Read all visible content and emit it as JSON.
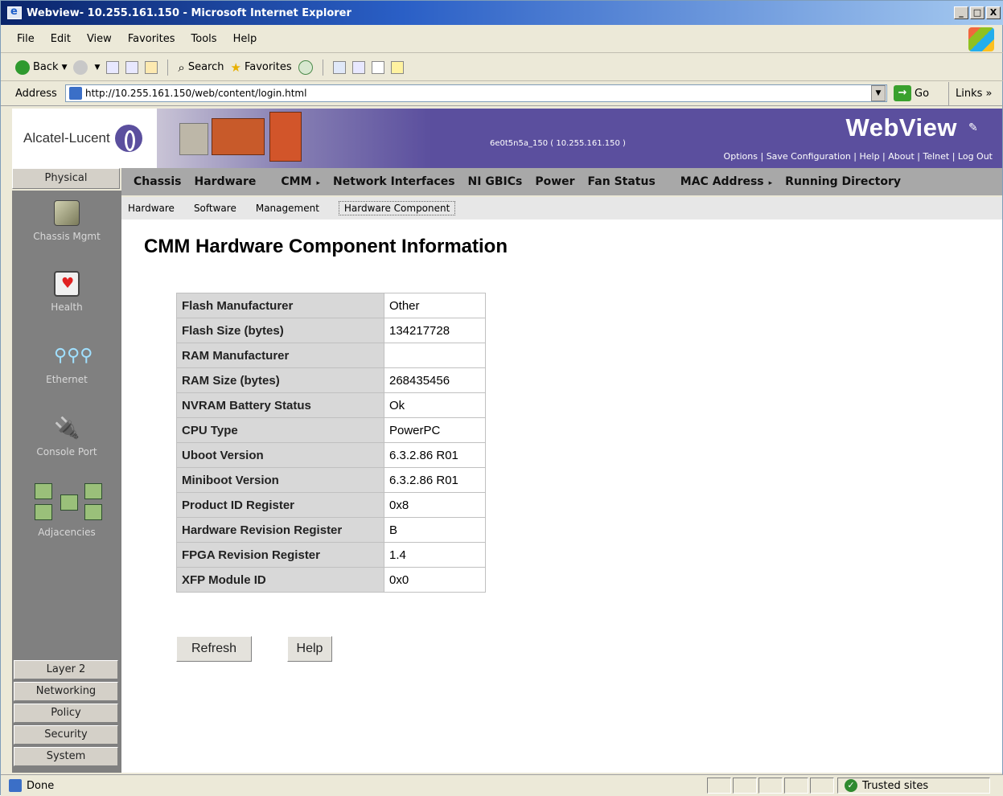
{
  "window": {
    "title": "Webview- 10.255.161.150 - Microsoft Internet Explorer",
    "buttons": [
      "_",
      "□",
      "X"
    ]
  },
  "menu": [
    "File",
    "Edit",
    "View",
    "Favorites",
    "Tools",
    "Help"
  ],
  "toolbar": {
    "back": "Back",
    "search": "Search",
    "favorites": "Favorites"
  },
  "address": {
    "label": "Address",
    "url": "http://10.255.161.150/web/content/login.html",
    "go": "Go",
    "links": "Links"
  },
  "banner": {
    "brand": "Alcatel-Lucent",
    "system": "6e0t5n5a_150 ( 10.255.161.150 )",
    "product": "WebView",
    "options": "Options  |  Save Configuration | Help | About | Telnet | Log Out"
  },
  "physical_tab": "Physical",
  "topnav": [
    "Chassis",
    "Hardware",
    "CMM",
    "Network Interfaces",
    "NI GBICs",
    "Power",
    "Fan Status",
    "MAC Address",
    "Running Directory"
  ],
  "subnav": [
    "Hardware",
    "Software",
    "Management",
    "Hardware Component"
  ],
  "sidebar": {
    "items": [
      "Chassis Mgmt",
      "Health",
      "Ethernet",
      "Console Port",
      "Adjacencies"
    ],
    "buttons": [
      "Layer 2",
      "Networking",
      "Policy",
      "Security",
      "System"
    ]
  },
  "main": {
    "title": "CMM Hardware Component Information",
    "rows": [
      {
        "label": "Flash Manufacturer",
        "value": "Other"
      },
      {
        "label": "Flash Size (bytes)",
        "value": "134217728"
      },
      {
        "label": "RAM Manufacturer",
        "value": ""
      },
      {
        "label": "RAM Size (bytes)",
        "value": "268435456"
      },
      {
        "label": "NVRAM Battery Status",
        "value": "Ok"
      },
      {
        "label": "CPU Type",
        "value": "PowerPC"
      },
      {
        "label": "Uboot Version",
        "value": "6.3.2.86 R01"
      },
      {
        "label": "Miniboot Version",
        "value": "6.3.2.86 R01"
      },
      {
        "label": "Product ID Register",
        "value": "0x8"
      },
      {
        "label": "Hardware Revision Register",
        "value": "B"
      },
      {
        "label": "FPGA Revision Register",
        "value": "1.4"
      },
      {
        "label": "XFP Module ID",
        "value": "0x0"
      }
    ],
    "refresh": "Refresh",
    "help": "Help"
  },
  "status": {
    "text": "Done",
    "zone": "Trusted sites"
  }
}
